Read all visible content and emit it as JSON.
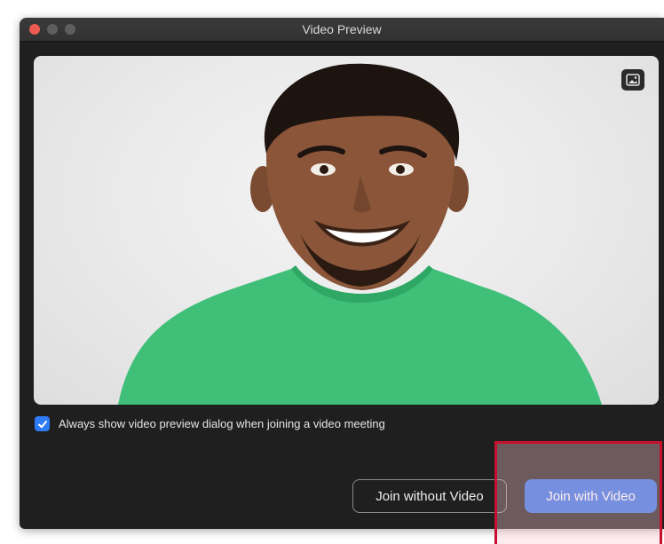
{
  "window": {
    "title": "Video Preview"
  },
  "preview": {
    "background_button_icon": "image-background-icon",
    "subject": "person-video-feed"
  },
  "options": {
    "always_show_checked": true,
    "always_show_label": "Always show video preview dialog when joining a video meeting"
  },
  "actions": {
    "join_without_video_label": "Join without Video",
    "join_with_video_label": "Join with Video"
  },
  "colors": {
    "primary_button": "#2d72e6",
    "checkbox": "#2d7cf6",
    "window_bg": "#1f1f1f",
    "highlight_border": "#c8102e",
    "shirt": "#3fbf78"
  }
}
